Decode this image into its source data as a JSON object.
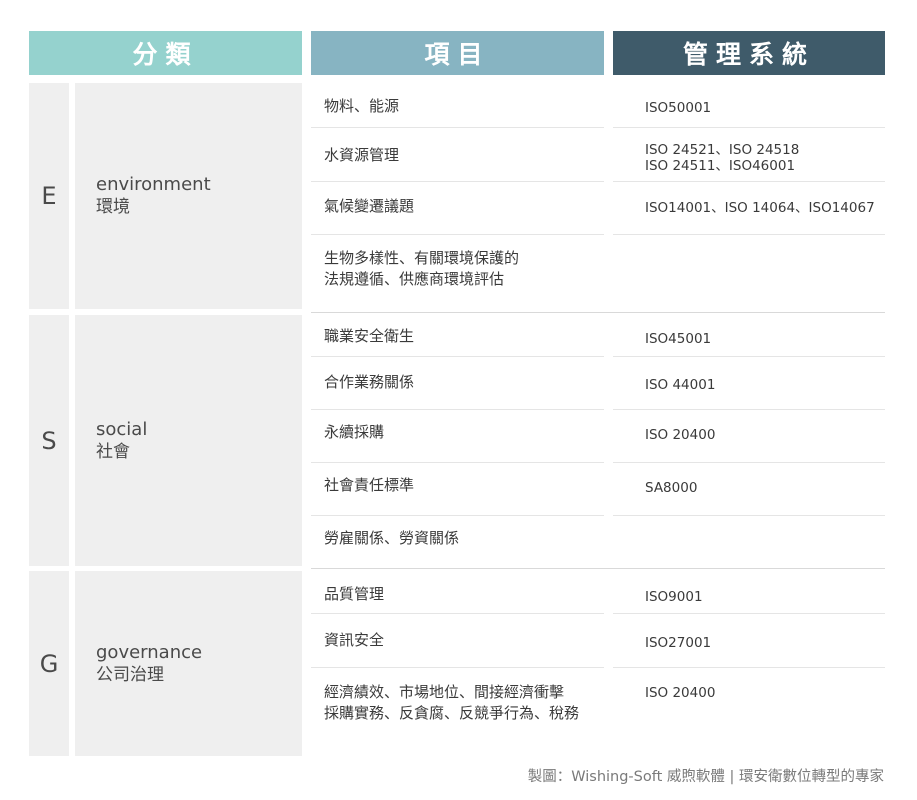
{
  "headers": {
    "category": "分類",
    "item": "項目",
    "system": "管理系統"
  },
  "sections": [
    {
      "letter": "E",
      "name_en": "environment",
      "name_zh": "環境",
      "rows": [
        {
          "item": "物料、能源",
          "system": "ISO50001"
        },
        {
          "item": "水資源管理",
          "system": "ISO 24521、ISO 24518\nISO 24511、ISO46001"
        },
        {
          "item": "氣候變遷議題",
          "system": "ISO14001、ISO 14064、ISO14067"
        },
        {
          "item": "生物多樣性、有關環境保護的\n法規遵循、供應商環境評估",
          "system": ""
        }
      ]
    },
    {
      "letter": "S",
      "name_en": "social",
      "name_zh": "社會",
      "rows": [
        {
          "item": "職業安全衛生",
          "system": "ISO45001"
        },
        {
          "item": "合作業務關係",
          "system": "ISO 44001"
        },
        {
          "item": "永續採購",
          "system": "ISO 20400"
        },
        {
          "item": "社會責任標準",
          "system": "SA8000"
        },
        {
          "item": "勞雇關係、勞資關係",
          "system": ""
        }
      ]
    },
    {
      "letter": "G",
      "name_en": "governance",
      "name_zh": "公司治理",
      "rows": [
        {
          "item": "品質管理",
          "system": "ISO9001"
        },
        {
          "item": "資訊安全",
          "system": "ISO27001"
        },
        {
          "item": "經濟績效、市場地位、間接經濟衝擊\n採購實務、反貪腐、反競爭行為、稅務",
          "system": "ISO 20400"
        }
      ]
    }
  ],
  "footer": "製圖：Wishing-Soft 威煦軟體 | 環安衛數位轉型的專家"
}
